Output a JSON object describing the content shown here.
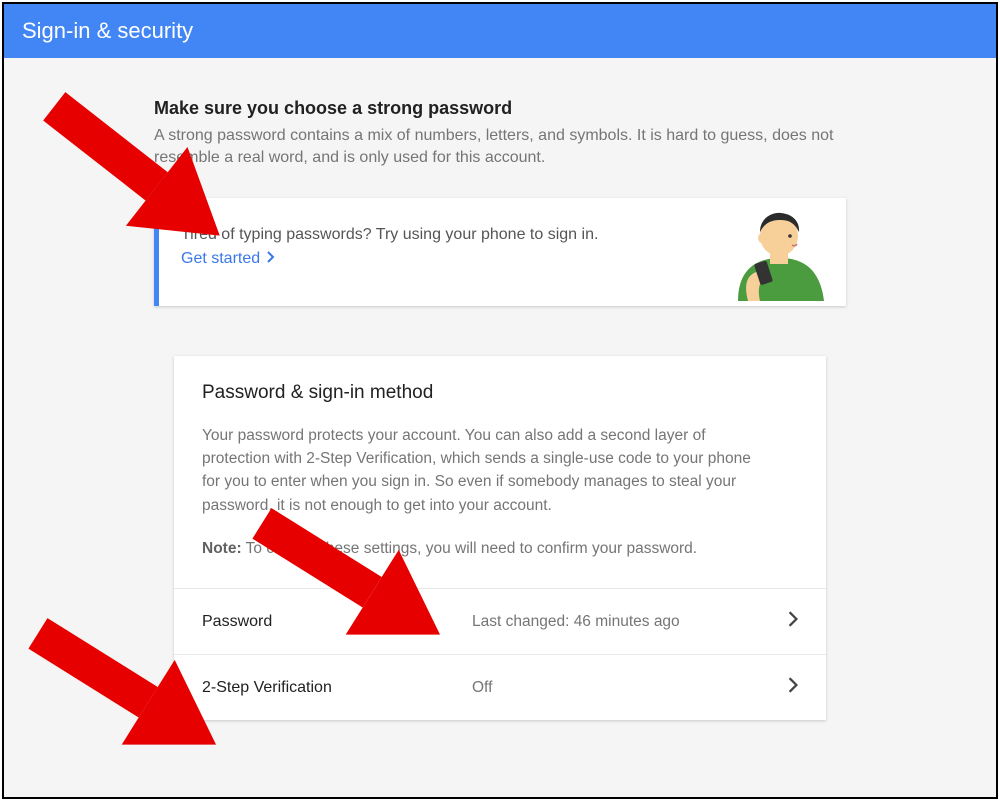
{
  "header": {
    "title": "Sign-in & security"
  },
  "intro": {
    "title": "Make sure you choose a strong password",
    "desc": "A strong password contains a mix of numbers, letters, and symbols. It is hard to guess, does not resemble a real word, and is only used for this account."
  },
  "promo": {
    "text": "Tired of typing passwords? Try using your phone to sign in.",
    "link_label": "Get started"
  },
  "card": {
    "title": "Password & sign-in method",
    "desc": "Your password protects your account. You can also add a second layer of protection with 2-Step Verification, which sends a single-use code to your phone for you to enter when you sign in. So even if somebody manages to steal your password, it is not enough to get into your account.",
    "note_label": "Note:",
    "note_text": " To change these settings, you will need to confirm your password."
  },
  "rows": {
    "password": {
      "label": "Password",
      "value": "Last changed: 46 minutes ago"
    },
    "twostep": {
      "label": "2-Step Verification",
      "value": "Off"
    }
  }
}
